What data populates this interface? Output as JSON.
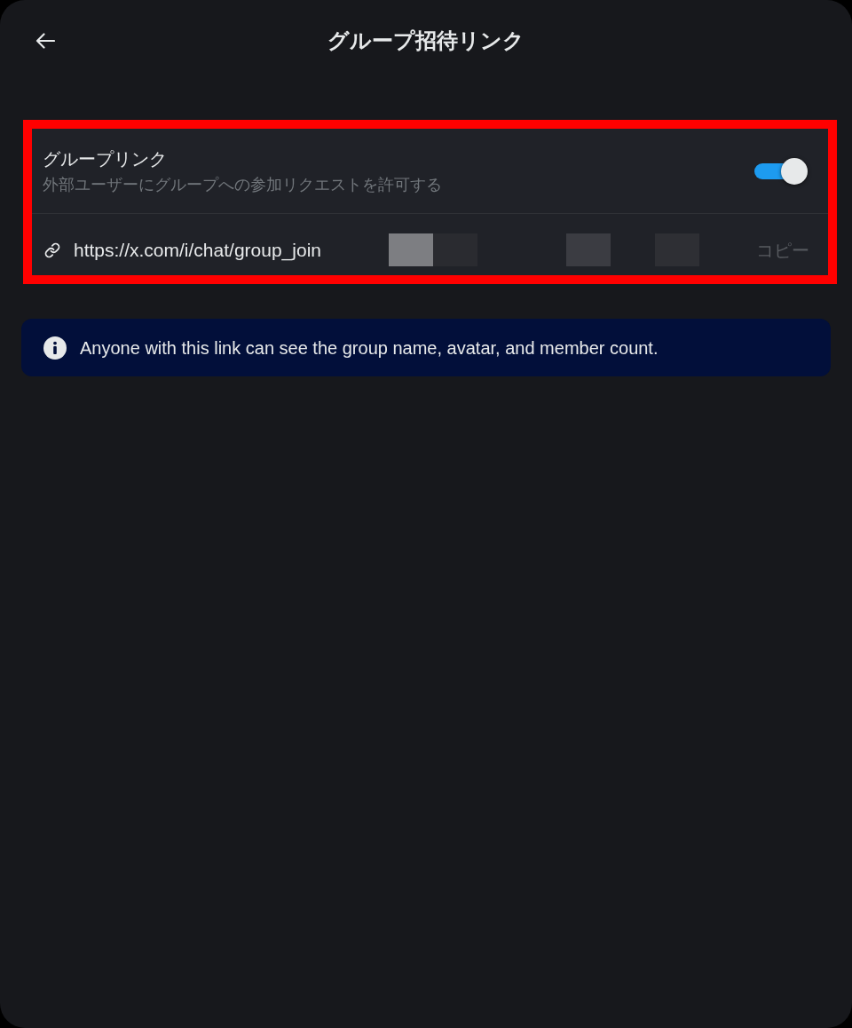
{
  "header": {
    "title": "グループ招待リンク"
  },
  "group_link": {
    "title": "グループリンク",
    "description": "外部ユーザーにグループへの参加リクエストを許可する",
    "on": true,
    "url": "https://x.com/i/chat/group_join",
    "copy_label": "コピー"
  },
  "notice": {
    "text": "Anyone with this link can see the group name, avatar, and member count."
  }
}
